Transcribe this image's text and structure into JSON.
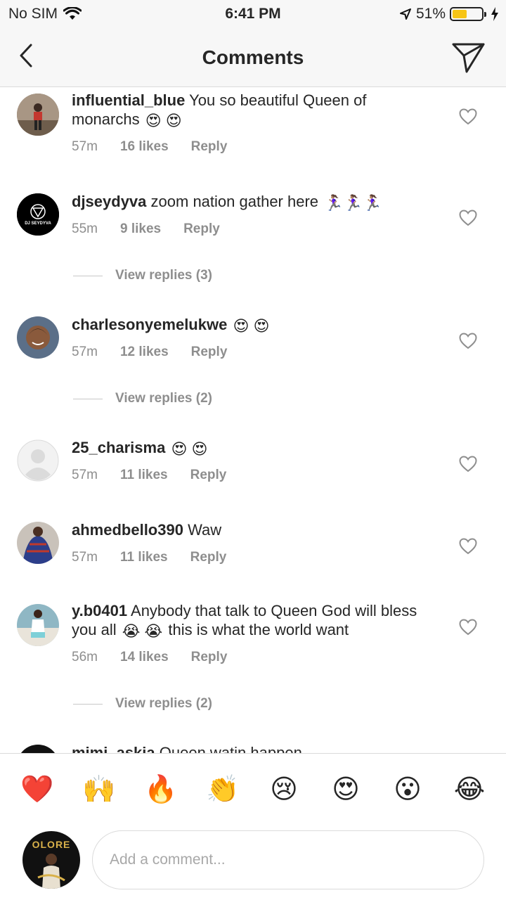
{
  "status_bar": {
    "carrier": "No SIM",
    "time": "6:41 PM",
    "battery_percent_label": "51%",
    "battery_level": 0.51
  },
  "header": {
    "title": "Comments"
  },
  "comments": [
    {
      "username": "influential_blue",
      "text": "You so beautiful Queen of monarchs",
      "emojis": "😍 😍",
      "time": "57m",
      "likes": "16 likes",
      "reply": "Reply"
    },
    {
      "username": "djseydyva",
      "text": "zoom nation gather here",
      "emojis": "🏃🏽‍♀️🏃🏽‍♀️🏃🏽‍♀️",
      "avatar_text": "DJ SEYDYVA",
      "time": "55m",
      "likes": "9 likes",
      "reply": "Reply",
      "view_replies": "View replies (3)"
    },
    {
      "username": "charlesonyemelukwe",
      "text": "",
      "emojis": "😍 😍",
      "time": "57m",
      "likes": "12 likes",
      "reply": "Reply",
      "view_replies": "View replies (2)"
    },
    {
      "username": "25_charisma",
      "text": "",
      "emojis": "😍 😍",
      "time": "57m",
      "likes": "11 likes",
      "reply": "Reply"
    },
    {
      "username": "ahmedbello390",
      "text": "Waw",
      "emojis": "",
      "time": "57m",
      "likes": "11 likes",
      "reply": "Reply"
    },
    {
      "username": "y.b0401",
      "text_a": "Anybody that talk to Queen God will bless you all",
      "emojis": "😭 😭",
      "text_b": "this is what the world want",
      "time": "56m",
      "likes": "14 likes",
      "reply": "Reply",
      "view_replies": "View replies (2)"
    },
    {
      "username": "mimi_askia",
      "text": "Queen watin happen"
    }
  ],
  "quick_emojis": [
    "❤️",
    "🙌",
    "🔥",
    "👏",
    "😢",
    "😍",
    "😮",
    "😂"
  ],
  "composer": {
    "placeholder": "Add a comment...",
    "avatar_text": "OLORE"
  },
  "colors": {
    "text": "#262626",
    "muted": "#8e8e8e",
    "divider": "#dbdbdb",
    "battery": "#f7c516"
  }
}
